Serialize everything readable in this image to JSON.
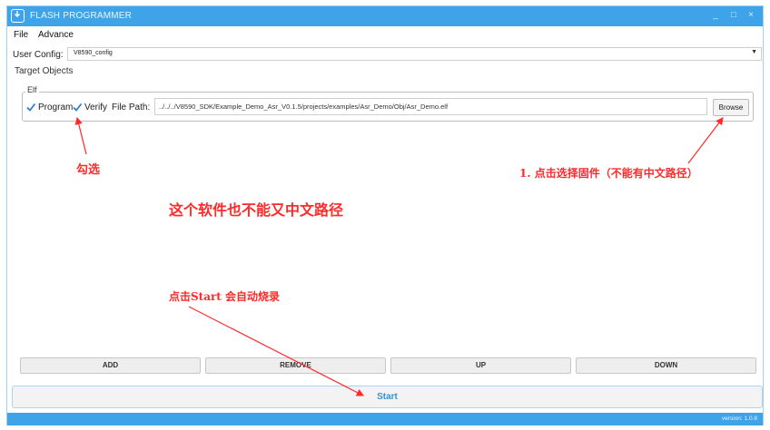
{
  "window": {
    "title": "FLASH PROGRAMMER",
    "minimize_glyph": "_",
    "maximize_glyph": "□",
    "close_glyph": "×"
  },
  "menu": {
    "items": [
      "File",
      "Advance"
    ]
  },
  "user_config": {
    "label": "User Config:",
    "value": "V8590_config"
  },
  "target_objects": {
    "label": "Target Objects"
  },
  "elf": {
    "legend": "Elf",
    "program": {
      "label": "Program",
      "checked": true
    },
    "verify": {
      "label": "Verify",
      "checked": true
    },
    "file_path_label": "File Path:",
    "file_path_value": "../../../V8590_SDK/Example_Demo_Asr_V0.1.5/projects/examples/Asr_Demo/Obj/Asr_Demo.elf",
    "browse_label": "Browse"
  },
  "actions": {
    "add": "ADD",
    "remove": "REMOVE",
    "up": "UP",
    "down": "DOWN"
  },
  "start_label": "Start",
  "version": "version: 1.0.8",
  "annotations": {
    "tick": "勾选",
    "choose_firmware": "1. 点击选择固件（不能有中文路径）",
    "no_chinese_path": "这个软件也不能又中文路径",
    "click_start": "点击Start  会自动烧录"
  },
  "colors": {
    "accent": "#3ea3e8",
    "annotation": "#ff2a2a",
    "start_text": "#3a8fd3"
  }
}
